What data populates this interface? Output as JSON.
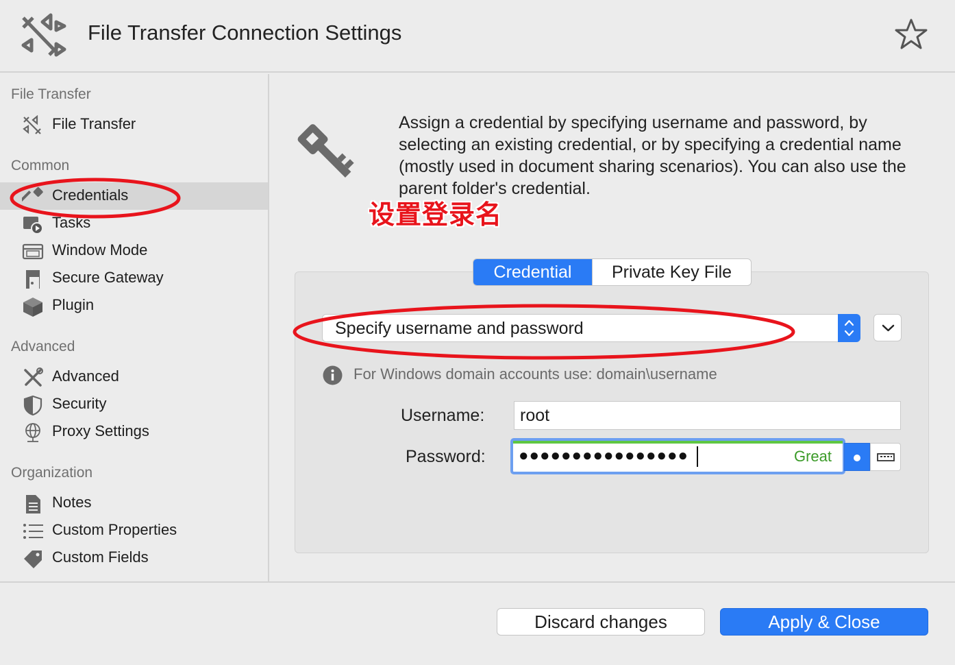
{
  "window": {
    "title": "File Transfer Connection Settings"
  },
  "sidebar": {
    "sections": [
      {
        "title": "File Transfer",
        "items": [
          {
            "label": "File Transfer",
            "icon": "file-transfer-icon"
          }
        ]
      },
      {
        "title": "Common",
        "items": [
          {
            "label": "Credentials",
            "icon": "key-icon",
            "selected": true
          },
          {
            "label": "Tasks",
            "icon": "tasks-icon"
          },
          {
            "label": "Window Mode",
            "icon": "window-icon"
          },
          {
            "label": "Secure Gateway",
            "icon": "gateway-icon"
          },
          {
            "label": "Plugin",
            "icon": "plugin-cube-icon"
          }
        ]
      },
      {
        "title": "Advanced",
        "items": [
          {
            "label": "Advanced",
            "icon": "tools-icon"
          },
          {
            "label": "Security",
            "icon": "shield-icon"
          },
          {
            "label": "Proxy Settings",
            "icon": "globe-icon"
          }
        ]
      },
      {
        "title": "Organization",
        "items": [
          {
            "label": "Notes",
            "icon": "notes-icon"
          },
          {
            "label": "Custom Properties",
            "icon": "list-icon"
          },
          {
            "label": "Custom Fields",
            "icon": "tag-icon"
          }
        ]
      }
    ]
  },
  "content": {
    "description": "Assign a credential by specifying username and password, by selecting an existing credential, or by specifying a credential name (mostly used in document sharing scenarios). You can also use the parent folder's credential.",
    "annotation": "设置登录名",
    "tabs": [
      {
        "label": "Credential",
        "active": true
      },
      {
        "label": "Private Key File",
        "active": false
      }
    ],
    "credential_mode": "Specify username and password",
    "info_text": "For Windows domain accounts use: domain\\username",
    "username_label": "Username:",
    "username_value": "root",
    "password_label": "Password:",
    "password_mask": "●●●●●●●●●●●●●●●●",
    "password_strength": "Great"
  },
  "footer": {
    "discard_label": "Discard changes",
    "apply_label": "Apply & Close"
  },
  "colors": {
    "accent": "#2a7bf5",
    "annotation_red": "#e8141c",
    "strength_green": "#3a9a27"
  }
}
